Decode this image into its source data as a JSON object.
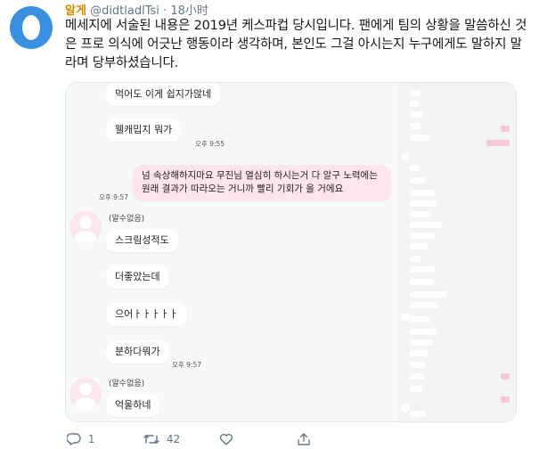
{
  "tweet": {
    "display_name": "알게",
    "handle": "@didtladlTsi",
    "separator": "·",
    "time": "18小时",
    "text": "메세지에 서술된 내용은 2019년 케스파컵 당시입니다. 팬에게 팀의 상황을 말씀하신 것은 프로 의식에 어긋난 행동이라 생각하며, 본인도 그걸 아시는지 누구에게도 말하지 말라며 당부하셨습니다."
  },
  "chat": {
    "msg1": "먹어도 이게 쉽지가않네",
    "msg2": "웰캐밉지 뭐가",
    "time1": "오후 9:55",
    "mine": "넘 속상해하지마요 무진님 열심히 하시는거 다 알구 노력에는 원래 결과가 따라오는 거니까 빨리 기회가 올 거에요",
    "time2": "오후 9:57",
    "sender1": "(알수없음)",
    "msg3": "스크림성적도",
    "msg4": "더좋았는데",
    "msg5": "으어ㅏㅏㅏㅏㅏ",
    "msg6": "분하다뭐가",
    "time3": "오후 9:57",
    "sender2": "(알수없음)",
    "msg7": "억울하네"
  },
  "actions": {
    "reply_count": "1",
    "retweet_count": "42",
    "reply_icon": "reply-icon",
    "retweet_icon": "retweet-icon",
    "like_icon": "heart-icon",
    "share_icon": "share-icon"
  },
  "colors": {
    "name": "#d18b00",
    "avatar": "#3b8fe0",
    "mine_bubble": "#fde4ee",
    "meta": "#657786"
  }
}
